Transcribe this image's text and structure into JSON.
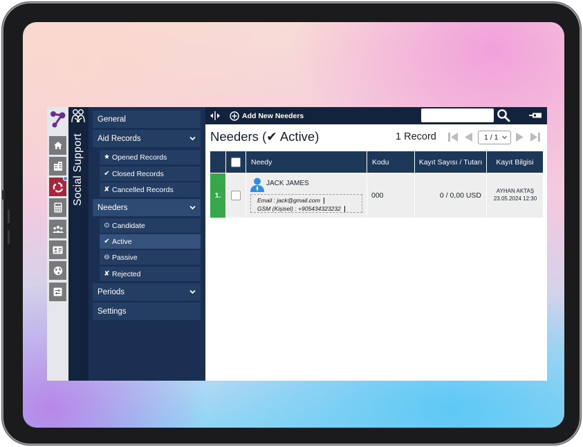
{
  "app": {
    "title": "Social Support"
  },
  "colors": {
    "navy": "#13233e",
    "menu": "#1a2f52",
    "accent_red": "#a8263a",
    "active_green": "#36a84a"
  },
  "rail": {
    "items": [
      {
        "icon": "home-icon"
      },
      {
        "icon": "building-icon"
      },
      {
        "icon": "recycle-icon",
        "active": true
      },
      {
        "icon": "calculator-icon"
      },
      {
        "icon": "group-icon"
      },
      {
        "icon": "id-card-icon"
      },
      {
        "icon": "globe-icon"
      },
      {
        "icon": "sliders-icon"
      }
    ]
  },
  "menu": {
    "general": "General",
    "aid_records": {
      "label": "Aid Records",
      "items": [
        {
          "glyph": "★",
          "label": "Opened Records"
        },
        {
          "glyph": "✔",
          "label": "Closed Records"
        },
        {
          "glyph": "✘",
          "label": "Cancelled Records"
        }
      ]
    },
    "needers": {
      "label": "Needers",
      "items": [
        {
          "glyph": "⊙",
          "label": "Candidate"
        },
        {
          "glyph": "✔",
          "label": "Active"
        },
        {
          "glyph": "⊖",
          "label": "Passive"
        },
        {
          "glyph": "✘",
          "label": "Rejected"
        }
      ]
    },
    "periods": "Periods",
    "settings": "Settings"
  },
  "toolbar": {
    "add_new_label": "Add New Needers",
    "search_placeholder": ""
  },
  "page": {
    "title": "Needers (✔ Active)",
    "record_count": "1 Record",
    "pagination_value": "1 / 1"
  },
  "table": {
    "headers": [
      "Needy",
      "Kodu",
      "Kayıt Sayısı / Tutarı",
      "Kayıt Bilgisi"
    ],
    "rows": [
      {
        "index": "1.",
        "name": "JACK JAMES",
        "email": "Email : jack@gmail.com",
        "gsm": "GSM (Kişisel) : +905434323232",
        "kodu": "000",
        "kayit_sayisi": "0 / 0,00 USD",
        "kayit_user": "AYHAN AKTAŞ",
        "kayit_date": "23.05.2024 12:30"
      }
    ]
  }
}
